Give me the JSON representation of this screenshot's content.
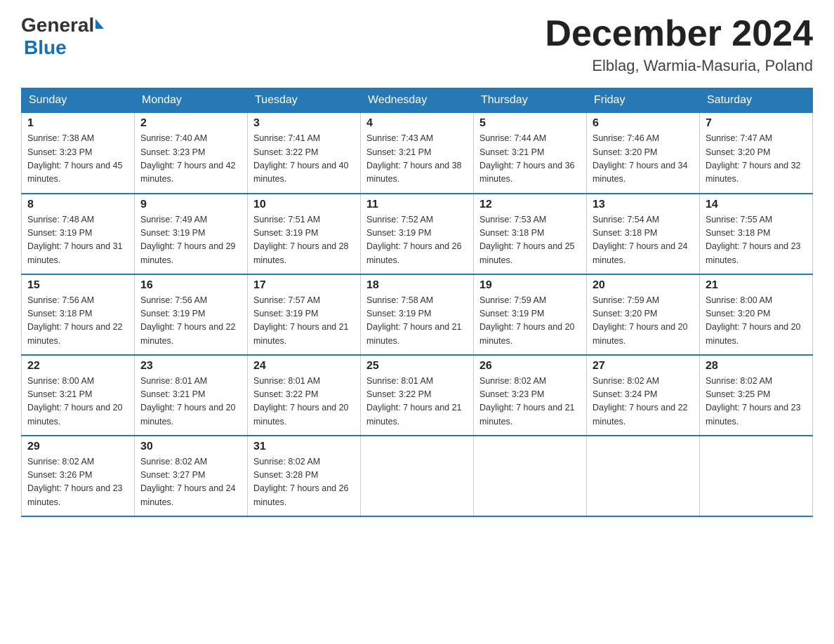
{
  "header": {
    "logo_general": "General",
    "logo_blue": "Blue",
    "month_title": "December 2024",
    "subtitle": "Elblag, Warmia-Masuria, Poland"
  },
  "days_of_week": [
    "Sunday",
    "Monday",
    "Tuesday",
    "Wednesday",
    "Thursday",
    "Friday",
    "Saturday"
  ],
  "weeks": [
    [
      {
        "day": 1,
        "sunrise": "7:38 AM",
        "sunset": "3:23 PM",
        "daylight": "7 hours and 45 minutes."
      },
      {
        "day": 2,
        "sunrise": "7:40 AM",
        "sunset": "3:23 PM",
        "daylight": "7 hours and 42 minutes."
      },
      {
        "day": 3,
        "sunrise": "7:41 AM",
        "sunset": "3:22 PM",
        "daylight": "7 hours and 40 minutes."
      },
      {
        "day": 4,
        "sunrise": "7:43 AM",
        "sunset": "3:21 PM",
        "daylight": "7 hours and 38 minutes."
      },
      {
        "day": 5,
        "sunrise": "7:44 AM",
        "sunset": "3:21 PM",
        "daylight": "7 hours and 36 minutes."
      },
      {
        "day": 6,
        "sunrise": "7:46 AM",
        "sunset": "3:20 PM",
        "daylight": "7 hours and 34 minutes."
      },
      {
        "day": 7,
        "sunrise": "7:47 AM",
        "sunset": "3:20 PM",
        "daylight": "7 hours and 32 minutes."
      }
    ],
    [
      {
        "day": 8,
        "sunrise": "7:48 AM",
        "sunset": "3:19 PM",
        "daylight": "7 hours and 31 minutes."
      },
      {
        "day": 9,
        "sunrise": "7:49 AM",
        "sunset": "3:19 PM",
        "daylight": "7 hours and 29 minutes."
      },
      {
        "day": 10,
        "sunrise": "7:51 AM",
        "sunset": "3:19 PM",
        "daylight": "7 hours and 28 minutes."
      },
      {
        "day": 11,
        "sunrise": "7:52 AM",
        "sunset": "3:19 PM",
        "daylight": "7 hours and 26 minutes."
      },
      {
        "day": 12,
        "sunrise": "7:53 AM",
        "sunset": "3:18 PM",
        "daylight": "7 hours and 25 minutes."
      },
      {
        "day": 13,
        "sunrise": "7:54 AM",
        "sunset": "3:18 PM",
        "daylight": "7 hours and 24 minutes."
      },
      {
        "day": 14,
        "sunrise": "7:55 AM",
        "sunset": "3:18 PM",
        "daylight": "7 hours and 23 minutes."
      }
    ],
    [
      {
        "day": 15,
        "sunrise": "7:56 AM",
        "sunset": "3:18 PM",
        "daylight": "7 hours and 22 minutes."
      },
      {
        "day": 16,
        "sunrise": "7:56 AM",
        "sunset": "3:19 PM",
        "daylight": "7 hours and 22 minutes."
      },
      {
        "day": 17,
        "sunrise": "7:57 AM",
        "sunset": "3:19 PM",
        "daylight": "7 hours and 21 minutes."
      },
      {
        "day": 18,
        "sunrise": "7:58 AM",
        "sunset": "3:19 PM",
        "daylight": "7 hours and 21 minutes."
      },
      {
        "day": 19,
        "sunrise": "7:59 AM",
        "sunset": "3:19 PM",
        "daylight": "7 hours and 20 minutes."
      },
      {
        "day": 20,
        "sunrise": "7:59 AM",
        "sunset": "3:20 PM",
        "daylight": "7 hours and 20 minutes."
      },
      {
        "day": 21,
        "sunrise": "8:00 AM",
        "sunset": "3:20 PM",
        "daylight": "7 hours and 20 minutes."
      }
    ],
    [
      {
        "day": 22,
        "sunrise": "8:00 AM",
        "sunset": "3:21 PM",
        "daylight": "7 hours and 20 minutes."
      },
      {
        "day": 23,
        "sunrise": "8:01 AM",
        "sunset": "3:21 PM",
        "daylight": "7 hours and 20 minutes."
      },
      {
        "day": 24,
        "sunrise": "8:01 AM",
        "sunset": "3:22 PM",
        "daylight": "7 hours and 20 minutes."
      },
      {
        "day": 25,
        "sunrise": "8:01 AM",
        "sunset": "3:22 PM",
        "daylight": "7 hours and 21 minutes."
      },
      {
        "day": 26,
        "sunrise": "8:02 AM",
        "sunset": "3:23 PM",
        "daylight": "7 hours and 21 minutes."
      },
      {
        "day": 27,
        "sunrise": "8:02 AM",
        "sunset": "3:24 PM",
        "daylight": "7 hours and 22 minutes."
      },
      {
        "day": 28,
        "sunrise": "8:02 AM",
        "sunset": "3:25 PM",
        "daylight": "7 hours and 23 minutes."
      }
    ],
    [
      {
        "day": 29,
        "sunrise": "8:02 AM",
        "sunset": "3:26 PM",
        "daylight": "7 hours and 23 minutes."
      },
      {
        "day": 30,
        "sunrise": "8:02 AM",
        "sunset": "3:27 PM",
        "daylight": "7 hours and 24 minutes."
      },
      {
        "day": 31,
        "sunrise": "8:02 AM",
        "sunset": "3:28 PM",
        "daylight": "7 hours and 26 minutes."
      },
      null,
      null,
      null,
      null
    ]
  ]
}
